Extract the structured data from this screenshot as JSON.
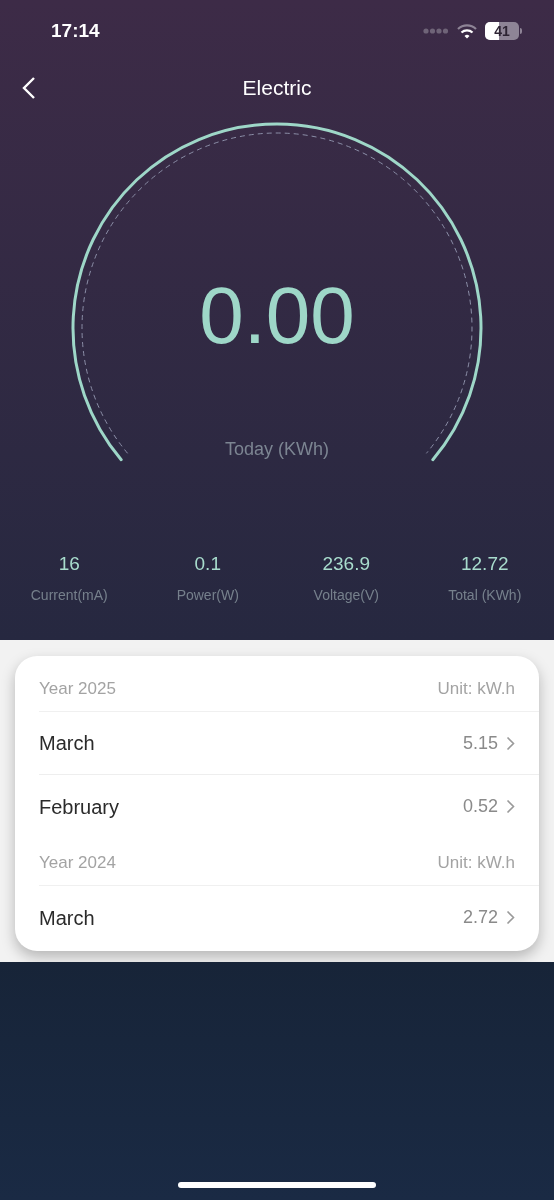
{
  "status_bar": {
    "time": "17:14",
    "battery": "41"
  },
  "header": {
    "title": "Electric"
  },
  "gauge": {
    "value": "0.00",
    "label": "Today (KWh)"
  },
  "stats": [
    {
      "value": "16",
      "label": "Current(mA)"
    },
    {
      "value": "0.1",
      "label": "Power(W)"
    },
    {
      "value": "236.9",
      "label": "Voltage(V)"
    },
    {
      "value": "12.72",
      "label": "Total (KWh)"
    }
  ],
  "groups": [
    {
      "year": "Year 2025",
      "unit": "Unit: kW.h",
      "months": [
        {
          "name": "March",
          "value": "5.15"
        },
        {
          "name": "February",
          "value": "0.52"
        }
      ]
    },
    {
      "year": "Year 2024",
      "unit": "Unit: kW.h",
      "months": [
        {
          "name": "March",
          "value": "2.72"
        }
      ]
    }
  ]
}
